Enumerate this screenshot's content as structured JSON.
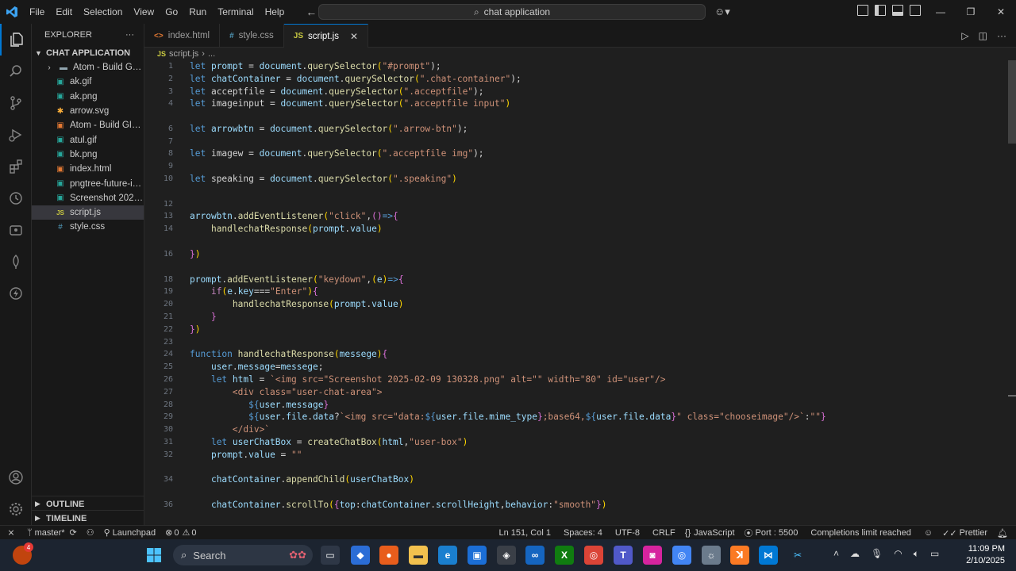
{
  "titlebar": {
    "menu": [
      "File",
      "Edit",
      "Selection",
      "View",
      "Go",
      "Run",
      "Terminal",
      "Help"
    ],
    "search_text": "chat application"
  },
  "tabs": [
    {
      "label": "index.html",
      "icon": "html-file-icon",
      "color": "#e37933"
    },
    {
      "label": "style.css",
      "icon": "css-file-icon",
      "color": "#519aba"
    },
    {
      "label": "script.js",
      "icon": "js-file-icon",
      "color": "#cbcb41"
    }
  ],
  "breadcrumb": {
    "file": "script.js",
    "rest": "..."
  },
  "explorer": {
    "title": "EXPLORER",
    "more": "···",
    "project": "CHAT APPLICATION",
    "items": [
      {
        "label": "Atom - Build GIF, ...",
        "type": "folder"
      },
      {
        "label": "ak.gif",
        "type": "image"
      },
      {
        "label": "ak.png",
        "type": "image"
      },
      {
        "label": "arrow.svg",
        "type": "svg"
      },
      {
        "label": "Atom - Build GIF, ...",
        "type": "html"
      },
      {
        "label": "atul.gif",
        "type": "image"
      },
      {
        "label": "bk.png",
        "type": "image"
      },
      {
        "label": "index.html",
        "type": "html"
      },
      {
        "label": "pngtree-future-in...",
        "type": "image"
      },
      {
        "label": "Screenshot 2025-...",
        "type": "image"
      },
      {
        "label": "script.js",
        "type": "js"
      },
      {
        "label": "style.css",
        "type": "css"
      }
    ],
    "outline": "OUTLINE",
    "timeline": "TIMELINE"
  },
  "code_lines": [
    {
      "n": "1",
      "t": 8
    },
    {
      "n": "2",
      "t": 24
    },
    {
      "n": "3",
      "t": 40
    },
    {
      "n": "4",
      "t": 55
    },
    {
      "n": "6",
      "t": 87
    },
    {
      "n": "7",
      "t": 103
    },
    {
      "n": "8",
      "t": 118
    },
    {
      "n": "9",
      "t": 134
    },
    {
      "n": "10",
      "t": 150
    },
    {
      "n": "12",
      "t": 182
    },
    {
      "n": "13",
      "t": 197
    },
    {
      "n": "14",
      "t": 213
    },
    {
      "n": "16",
      "t": 245
    },
    {
      "n": "18",
      "t": 277
    },
    {
      "n": "19",
      "t": 292
    },
    {
      "n": "20",
      "t": 308
    },
    {
      "n": "21",
      "t": 324
    },
    {
      "n": "22",
      "t": 340
    },
    {
      "n": "23",
      "t": 356
    },
    {
      "n": "24",
      "t": 371
    },
    {
      "n": "25",
      "t": 387
    },
    {
      "n": "26",
      "t": 403
    },
    {
      "n": "27",
      "t": 419
    },
    {
      "n": "28",
      "t": 435
    },
    {
      "n": "29",
      "t": 450
    },
    {
      "n": "30",
      "t": 466
    },
    {
      "n": "31",
      "t": 482
    },
    {
      "n": "32",
      "t": 498
    },
    {
      "n": "34",
      "t": 529
    },
    {
      "n": "36",
      "t": 561
    }
  ],
  "code": {
    "l1": [
      "let",
      " prompt ",
      "=",
      " document",
      ".",
      "querySelector",
      "(",
      "\"#prompt\"",
      ");"
    ],
    "l2": [
      "let",
      " chatContainer ",
      "=",
      " document",
      ".",
      "querySelector",
      "(",
      "\".chat-container\"",
      ");"
    ],
    "l3": [
      "let",
      " acceptfile ",
      "=",
      " document",
      ".",
      "querySelector",
      "(",
      "\".acceptfile\"",
      ");"
    ],
    "l4": [
      "let",
      " imageinput ",
      "=",
      " document",
      ".",
      "querySelector",
      "(",
      "\".acceptfile input\"",
      ")"
    ],
    "l6": [
      "let",
      " arrowbtn ",
      "=",
      " document",
      ".",
      "querySelector",
      "(",
      "\".arrow-btn\"",
      ");"
    ],
    "l8": [
      "let",
      " imagew ",
      "=",
      " document",
      ".",
      "querySelector",
      "(",
      "\".acceptfile img\"",
      ");"
    ],
    "l10": [
      "let",
      " speaking ",
      "=",
      " document",
      ".",
      "querySelector",
      "(",
      "\".speaking\"",
      ")"
    ],
    "l13": [
      "arrowbtn",
      ".",
      "addEventListener",
      "(",
      "\"click\"",
      ",",
      "()",
      "=>",
      "{"
    ],
    "l14": [
      "    ",
      "handlechatResponse",
      "(",
      "prompt",
      ".",
      "value",
      ")"
    ],
    "l16": [
      "}",
      ")"
    ],
    "l18": [
      "prompt",
      ".",
      "addEventListener",
      "(",
      "\"keydown\"",
      ",",
      "(",
      "e",
      ")",
      "=>",
      "{"
    ],
    "l19": [
      "    ",
      "if",
      "(",
      "e",
      ".",
      "key",
      "===",
      "\"Enter\"",
      ")",
      "{"
    ],
    "l20": [
      "        ",
      "handlechatResponse",
      "(",
      "prompt",
      ".",
      "value",
      ")"
    ],
    "l21": [
      "    ",
      "}"
    ],
    "l22": [
      "}",
      ")"
    ],
    "l24": [
      "function",
      " ",
      "handlechatResponse",
      "(",
      "messege",
      ")",
      "{"
    ],
    "l25": [
      "    ",
      "user",
      ".",
      "message",
      "=",
      "messege",
      ";"
    ],
    "l26": [
      "    ",
      "let",
      " html ",
      "=",
      " ",
      "`<img src=\"Screenshot 2025-02-09 130328.png\" alt=\"\" width=\"80\" id=\"user\"/>"
    ],
    "l27": [
      "        ",
      "<div class=\"user-chat-area\">"
    ],
    "l28": [
      "           ",
      "${",
      "user",
      ".",
      "message",
      "}"
    ],
    "l29": [
      "           ",
      "${",
      "user",
      ".",
      "file",
      ".",
      "data",
      "?",
      "`<img src=\"data:",
      "${",
      "user.file.mime_type",
      "}",
      ";base64,",
      "${",
      "user.file.data",
      "}",
      "\" class=\"chooseimage\"/>`",
      ":",
      "\"\"",
      "}"
    ],
    "l30": [
      "        ",
      "</div>`"
    ],
    "l31": [
      "    ",
      "let",
      " userChatBox ",
      "=",
      " ",
      "createChatBox",
      "(",
      "html",
      ",",
      "\"user-box\"",
      ")"
    ],
    "l32": [
      "    ",
      "prompt",
      ".",
      "value",
      " = ",
      "\"\""
    ],
    "l34": [
      "    ",
      "chatContainer",
      ".",
      "appendChild",
      "(",
      "userChatBox",
      ")"
    ],
    "l36": [
      "    ",
      "chatContainer",
      ".",
      "scrollTo",
      "(",
      "{",
      "top",
      ":",
      "chatContainer",
      ".",
      "scrollHeight",
      ",",
      "behavior",
      ":",
      "\"smooth\"",
      "}",
      ")"
    ]
  },
  "status": {
    "branch": "master*",
    "launchpad": "Launchpad",
    "problems": "0",
    "warnings": "0",
    "position": "Ln 151, Col 1",
    "spaces": "Spaces: 4",
    "encoding": "UTF-8",
    "eol": "CRLF",
    "language": "JavaScript",
    "port": "Port : 5500",
    "completions": "Completions limit reached",
    "prettier": "Prettier"
  },
  "taskbar": {
    "search": "Search",
    "time": "11:09 PM",
    "date": "2/10/2025",
    "badge": "4"
  },
  "colors": {
    "accent": "#0078d4",
    "editor_bg": "#1f1f1f",
    "chrome_bg": "#181818"
  }
}
